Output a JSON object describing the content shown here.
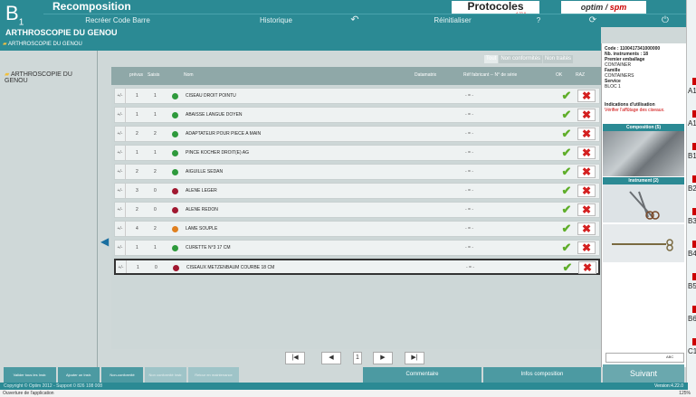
{
  "header": {
    "logo": "B",
    "logo_sub": "1",
    "app_title": "Recomposition",
    "protocoles": "Protocoles",
    "protocoles_version": "4.22.0",
    "brand_prefix": "optim",
    "brand_suffix": "spm",
    "brand_accent": "#cc0000"
  },
  "menu": {
    "recreate": "Recréer Code Barre",
    "historique": "Historique",
    "reinit": "Réinitialiser",
    "help": "?"
  },
  "section_title": "ARTHROSCOPIE DU GENOU",
  "subheader_label": "ARTHROSCOPIE DU GENOU",
  "filters": {
    "tout": "Tout",
    "nonconf": "Non conformités",
    "nontraites": "Non traités"
  },
  "tree": {
    "item": "ARTHROSCOPIE DU GENOU"
  },
  "grid": {
    "headers": {
      "prevus": "prévus",
      "saisis": "Saisis",
      "nom": "Nom",
      "datamatrix": "Datamatrix",
      "ref": "Réf fabricant -- N° de série",
      "ok": "OK",
      "raz": "RAZ"
    },
    "rows": [
      {
        "pm": "+/-",
        "prevus": "1",
        "saisis": "1",
        "status": "#2e9a3c",
        "nom": "CISEAU DROIT POINTU",
        "ref": "- = -"
      },
      {
        "pm": "+/-",
        "prevus": "1",
        "saisis": "1",
        "status": "#2e9a3c",
        "nom": "ABAISSE LANGUE DOYEN",
        "ref": "- = -"
      },
      {
        "pm": "+/-",
        "prevus": "2",
        "saisis": "2",
        "status": "#2e9a3c",
        "nom": "ADAPTATEUR POUR PIECE A MAIN",
        "ref": "- = -"
      },
      {
        "pm": "+/-",
        "prevus": "1",
        "saisis": "1",
        "status": "#2e9a3c",
        "nom": "PINCE KOCHER DROIT(E) AG",
        "ref": "- = -"
      },
      {
        "pm": "+/-",
        "prevus": "2",
        "saisis": "2",
        "status": "#2e9a3c",
        "nom": "AIGUILLE SEDAN",
        "ref": "- = -"
      },
      {
        "pm": "+/-",
        "prevus": "3",
        "saisis": "0",
        "status": "#a01830",
        "nom": "ALENE LEGER",
        "ref": "- = -"
      },
      {
        "pm": "+/-",
        "prevus": "2",
        "saisis": "0",
        "status": "#a01830",
        "nom": "ALENE REDON",
        "ref": "- = -"
      },
      {
        "pm": "+/-",
        "prevus": "4",
        "saisis": "2",
        "status": "#e08020",
        "nom": "LAME SOUPLE",
        "ref": "- = -"
      },
      {
        "pm": "+/-",
        "prevus": "1",
        "saisis": "1",
        "status": "#2e9a3c",
        "nom": "CURETTE N°3 17 CM",
        "ref": "- = -"
      },
      {
        "pm": "+/-",
        "prevus": "1",
        "saisis": "0",
        "status": "#a01830",
        "nom": "CISEAUX METZENBAUM COURBE 18 CM",
        "ref": "- = -"
      }
    ]
  },
  "pager": {
    "page": "1",
    "first": "|◀",
    "prev": "◀",
    "next": "▶",
    "last": "▶|"
  },
  "bottom_buttons": {
    "valider": "Valider tous les Instr.",
    "ajouter": "Ajouter un Instr.",
    "nonconf": "Non-conformité",
    "nonconf2": "Non conformité Instr.",
    "retour": "Retour en maintenance",
    "commentaire": "Commentaire",
    "infos": "Infos composition"
  },
  "side": {
    "code": "Code : 1100417341000000",
    "nb": "Nb. instruments : 18",
    "emballage_label": "Premier emballage",
    "emballage": "CONTAINER",
    "famille_label": "Famille",
    "famille": "CONTAINERS",
    "service_label": "Service",
    "service": "BLOC 1",
    "indic_label": "Indications d'utilisation",
    "indic_text": "Vérifier l'affûtage des ciseaux.",
    "composition": "Composition (5)",
    "instrument": "Instrument (2)",
    "abc": "ABC",
    "suivant": "Suivant"
  },
  "footer": {
    "copyright": "Copyright © Optim 2012 - Support 0 826 108 008",
    "version": "Version:4.22.0"
  },
  "statusbar": {
    "text": "Ouverture de l'application",
    "zoom": "125%"
  },
  "right_strip": [
    "A1",
    "A1",
    "B1",
    "B2",
    "B3",
    "B4",
    "B5",
    "B6",
    "C1"
  ]
}
